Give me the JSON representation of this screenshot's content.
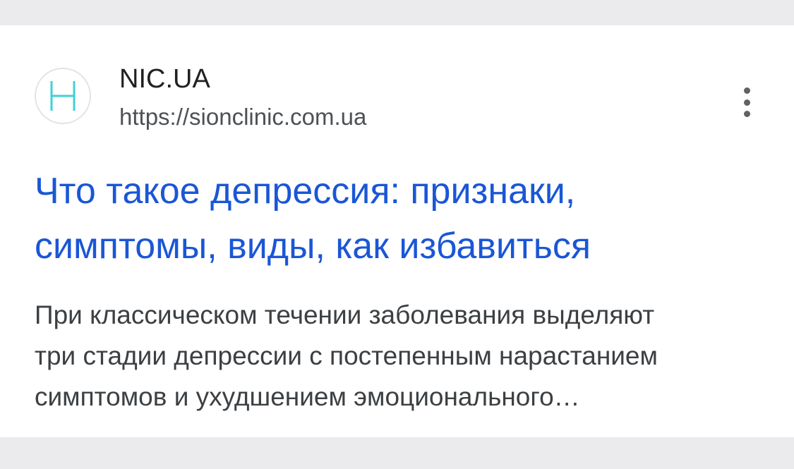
{
  "result": {
    "favicon": {
      "letter": "H",
      "color": "#3fd0d8",
      "icon": "letter-h-icon"
    },
    "site_name": "NIC.UA",
    "url": "https://sionclinic.com.ua",
    "more_icon": "three-dots-vertical-icon",
    "title_lines": [
      "Что такое депрессия: признаки,",
      "симптомы, виды, как избавиться"
    ],
    "snippet_lines": [
      "При классическом течении заболевания выделяют",
      "три стадии депрессии с постепенным нарастанием",
      "симптомов и ухудшением эмоционального…"
    ],
    "colors": {
      "title": "#1a56d6",
      "snippet": "#3c4043",
      "background": "#ebebed"
    }
  }
}
